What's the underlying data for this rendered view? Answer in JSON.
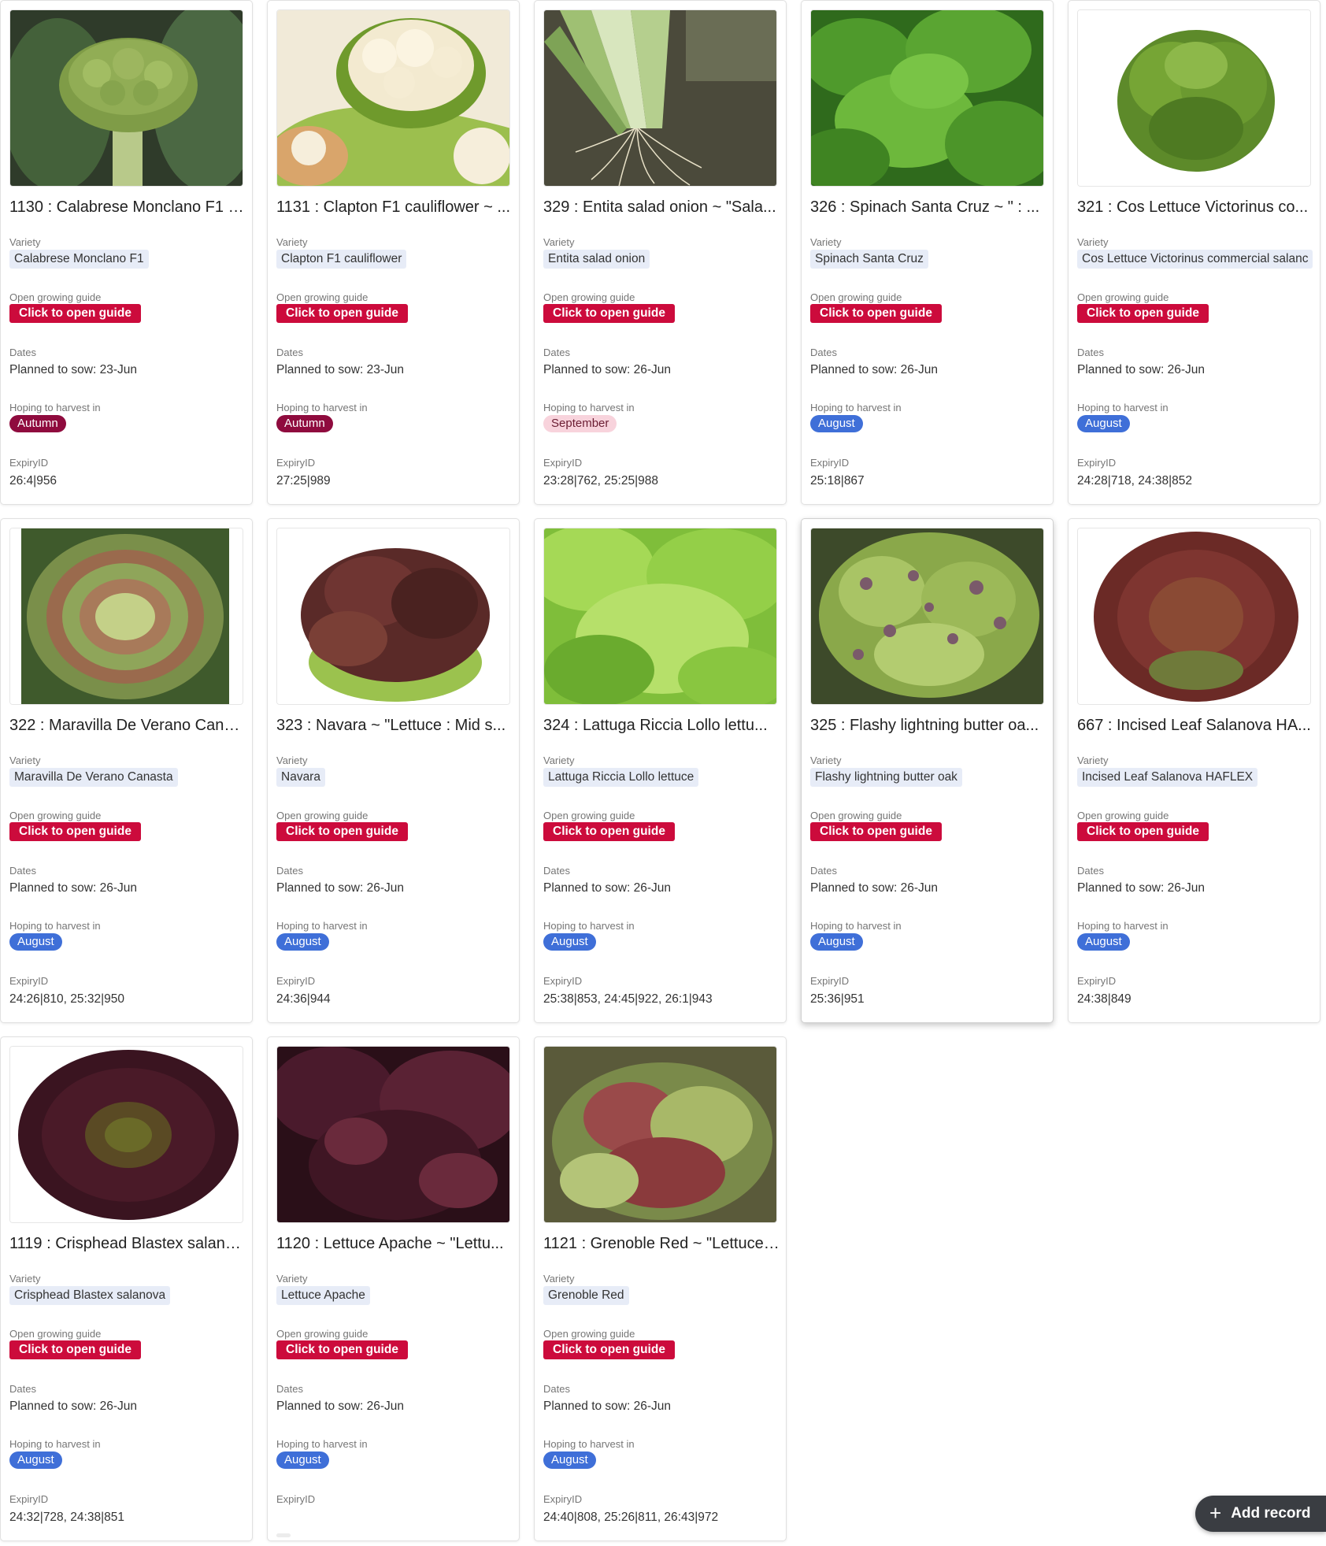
{
  "labels": {
    "variety": "Variety",
    "guide": "Open growing guide",
    "dates": "Dates",
    "harvest": "Hoping to harvest in",
    "expiry": "ExpiryID"
  },
  "add_record": "Add record",
  "cards": [
    {
      "title": "1130 : Calabrese Monclano F1 ~...",
      "variety": "Calabrese Monclano F1",
      "button": "Click to open guide",
      "dates": "Planned to sow: 23-Jun",
      "harvest": "Autumn",
      "expiry": "26:4|956",
      "image": "broccoli-image"
    },
    {
      "title": "1131 : Clapton F1 cauliflower ~ ...",
      "variety": "Clapton F1 cauliflower",
      "button": "Click to open guide",
      "dates": "Planned to sow: 23-Jun",
      "harvest": "Autumn",
      "expiry": "27:25|989",
      "image": "cauliflower-image"
    },
    {
      "title": "329 : Entita salad onion ~ \"Sala...",
      "variety": "Entita salad onion",
      "button": "Click to open guide",
      "dates": "Planned to sow: 26-Jun",
      "harvest": "September",
      "expiry": "23:28|762, 25:25|988",
      "image": "onion-image"
    },
    {
      "title": "326 : Spinach Santa Cruz ~ \" : ...",
      "variety": "Spinach Santa Cruz",
      "button": "Click to open guide",
      "dates": "Planned to sow: 26-Jun",
      "harvest": "August",
      "expiry": "25:18|867",
      "image": "spinach-image"
    },
    {
      "title": "321 : Cos Lettuce Victorinus co...",
      "variety": "Cos Lettuce Victorinus commercial salanc",
      "button": "Click to open guide",
      "dates": "Planned to sow: 26-Jun",
      "harvest": "August",
      "expiry": "24:28|718, 24:38|852",
      "image": "cos-lettuce-image"
    },
    {
      "title": "322 : Maravilla De Verano Cana...",
      "variety": "Maravilla De Verano Canasta",
      "button": "Click to open guide",
      "dates": "Planned to sow: 26-Jun",
      "harvest": "August",
      "expiry": "24:26|810, 25:32|950",
      "image": "maravilla-lettuce-image"
    },
    {
      "title": "323 : Navara ~ \"Lettuce : Mid s...",
      "variety": "Navara",
      "button": "Click to open guide",
      "dates": "Planned to sow: 26-Jun",
      "harvest": "August",
      "expiry": "24:36|944",
      "image": "navara-lettuce-image"
    },
    {
      "title": "324 : Lattuga Riccia Lollo lettu...",
      "variety": "Lattuga Riccia Lollo lettuce",
      "button": "Click to open guide",
      "dates": "Planned to sow: 26-Jun",
      "harvest": "August",
      "expiry": "25:38|853, 24:45|922, 26:1|943",
      "image": "lollo-lettuce-image"
    },
    {
      "title": "325 : Flashy lightning butter oa...",
      "variety": "Flashy lightning butter oak",
      "button": "Click to open guide",
      "dates": "Planned to sow: 26-Jun",
      "harvest": "August",
      "expiry": "25:36|951",
      "image": "butter-oak-image"
    },
    {
      "title": "667 : Incised Leaf Salanova HA...",
      "variety": "Incised Leaf Salanova HAFLEX",
      "button": "Click to open guide",
      "dates": "Planned to sow: 26-Jun",
      "harvest": "August",
      "expiry": "24:38|849",
      "image": "salanova-image"
    },
    {
      "title": "1119 : Crisphead Blastex salano...",
      "variety": "Crisphead Blastex salanova",
      "button": "Click to open guide",
      "dates": "Planned to sow: 26-Jun",
      "harvest": "August",
      "expiry": "24:32|728, 24:38|851",
      "image": "blastex-image"
    },
    {
      "title": "1120 : Lettuce Apache ~ \"Lettu...",
      "variety": "Lettuce Apache",
      "button": "Click to open guide",
      "dates": "Planned to sow: 26-Jun",
      "harvest": "August",
      "expiry": "",
      "image": "apache-lettuce-image"
    },
    {
      "title": "1121 : Grenoble Red ~ \"Lettuce ...",
      "variety": "Grenoble Red",
      "button": "Click to open guide",
      "dates": "Planned to sow: 26-Jun",
      "harvest": "August",
      "expiry": "24:40|808, 25:26|811, 26:43|972",
      "image": "grenoble-red-image"
    }
  ],
  "colors": {
    "guide_button": "#cc0b3c",
    "autumn": "#8f0b3e",
    "september": "#f8d3dc",
    "august": "#3f6fd8",
    "variety_chip": "#e7ecf7",
    "fab": "#3a3d42"
  }
}
